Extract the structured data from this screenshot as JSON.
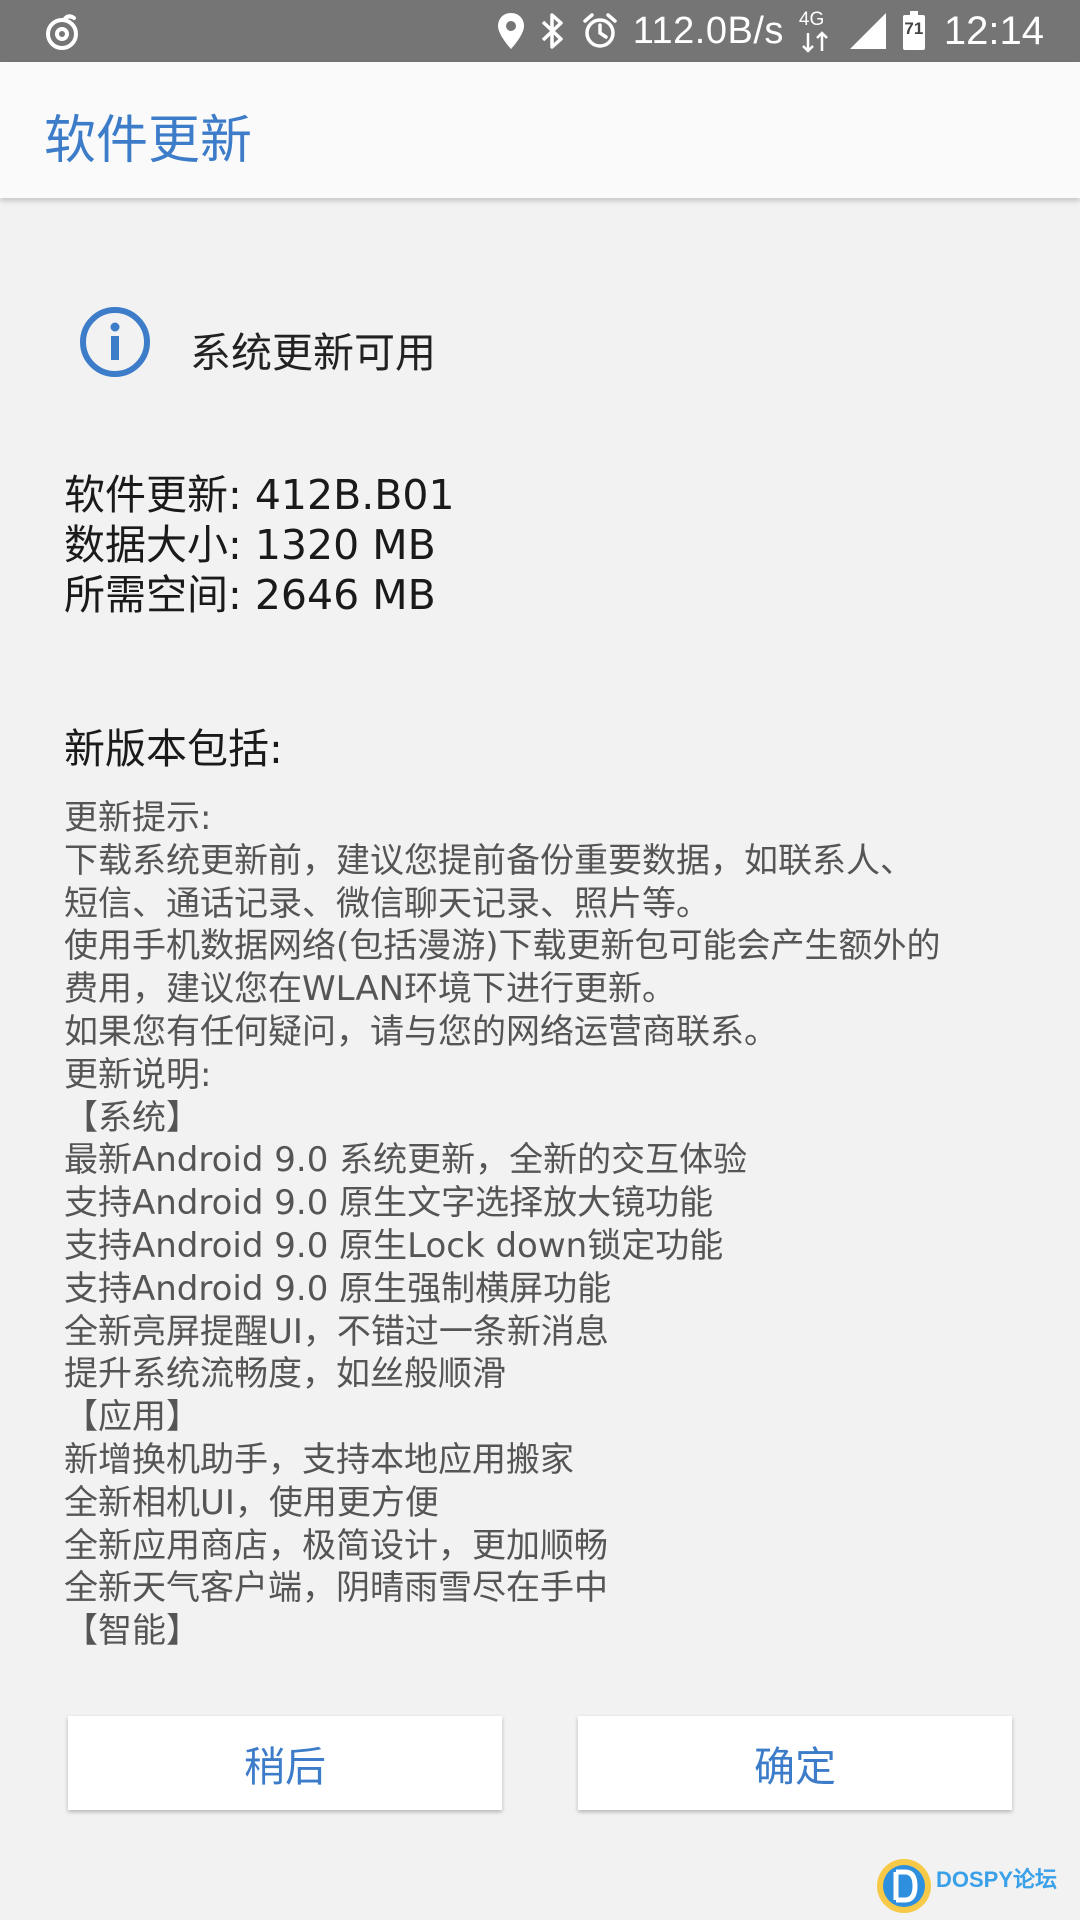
{
  "status_bar": {
    "net_speed": "112.0B/s",
    "network_type": "4G",
    "battery_level": "71",
    "time": "12:14",
    "icons": [
      "netease-music-icon",
      "location-icon",
      "bluetooth-icon",
      "alarm-icon",
      "signal-icon",
      "battery-icon"
    ]
  },
  "app_bar": {
    "title": "软件更新"
  },
  "update": {
    "header": "系统更新可用",
    "version_line": "软件更新: 412B.B01",
    "size_line": "数据大小: 1320 MB",
    "space_line": "所需空间: 2646 MB",
    "section_title": "新版本包括:"
  },
  "notes": {
    "lines": [
      "更新提示:",
      "下载系统更新前，建议您提前备份重要数据，如联系人、",
      "短信、通话记录、微信聊天记录、照片等。",
      "使用手机数据网络(包括漫游)下载更新包可能会产生额外的",
      "费用，建议您在WLAN环境下进行更新。",
      "如果您有任何疑问，请与您的网络运营商联系。",
      "更新说明:",
      "【系统】",
      "最新Android 9.0 系统更新，全新的交互体验",
      "支持Android 9.0 原生文字选择放大镜功能",
      "支持Android 9.0 原生Lock down锁定功能",
      "支持Android 9.0 原生强制横屏功能",
      "全新亮屏提醒UI，不错过一条新消息",
      "提升系统流畅度，如丝般顺滑",
      "【应用】",
      "新增换机助手，支持本地应用搬家",
      "全新相机UI，使用更方便",
      "全新应用商店，极简设计，更加顺畅",
      "全新天气客户端，阴晴雨雪尽在手中",
      "【智能】"
    ]
  },
  "buttons": {
    "later": "稍后",
    "ok": "确定"
  },
  "watermark": {
    "text": "DOSPY论坛"
  },
  "colors": {
    "accent": "#3d7cc9",
    "status_bar": "#757575",
    "background": "#f2f2f2"
  }
}
